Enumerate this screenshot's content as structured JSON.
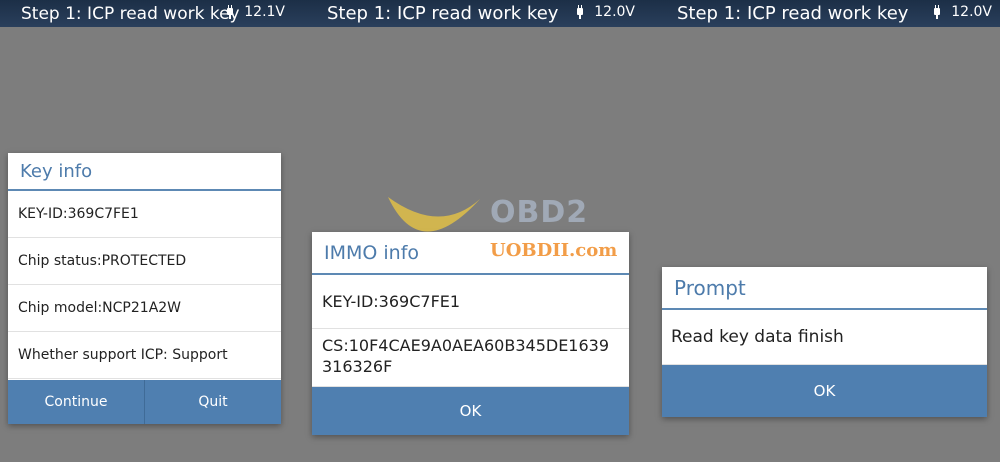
{
  "screens": [
    {
      "header": {
        "title": "Step 1: ICP read work key",
        "voltage": "12.1V"
      },
      "dialog": {
        "title": "Key info",
        "rows": [
          "KEY-ID:369C7FE1",
          "Chip status:PROTECTED",
          "Chip model:NCP21A2W",
          "Whether support ICP: Support"
        ],
        "buttons": [
          "Continue",
          "Quit"
        ]
      }
    },
    {
      "header": {
        "title": "Step 1: ICP read work key",
        "voltage": "12.0V"
      },
      "dialog": {
        "title": "IMMO info",
        "rows": [
          "KEY-ID:369C7FE1",
          "CS:10F4CAE9A0AEA60B345DE1639316326F"
        ],
        "buttons": [
          "OK"
        ]
      }
    },
    {
      "header": {
        "title": "Step 1: ICP read work key",
        "voltage": "12.0V"
      },
      "dialog": {
        "title": "Prompt",
        "rows": [
          "Read key data finish"
        ],
        "buttons": [
          "OK"
        ]
      }
    }
  ],
  "watermark": {
    "logo_text": "OBD2",
    "site": "UOBDII.com"
  },
  "colors": {
    "header": "#24384f",
    "accent": "#4f7fb0",
    "title_text": "#4d7bab",
    "background": "#7d7d7d"
  },
  "icons": {
    "power": "plug-icon"
  }
}
